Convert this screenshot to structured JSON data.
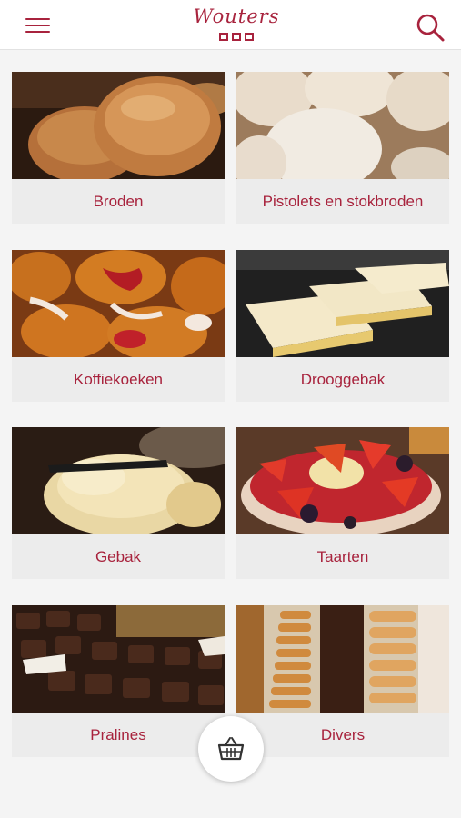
{
  "header": {
    "logo_text": "Wouters",
    "menu_icon": "hamburger-menu-icon",
    "search_icon": "search-icon"
  },
  "categories": [
    {
      "label": "Broden"
    },
    {
      "label": "Pistolets en stokbroden"
    },
    {
      "label": "Koffiekoeken"
    },
    {
      "label": "Drooggebak"
    },
    {
      "label": "Gebak"
    },
    {
      "label": "Taarten"
    },
    {
      "label": "Pralines"
    },
    {
      "label": "Divers"
    }
  ],
  "cart": {
    "icon": "shopping-basket-icon"
  },
  "colors": {
    "accent": "#a8233d",
    "background": "#f4f4f4",
    "tile_label_bg": "#ececec"
  }
}
